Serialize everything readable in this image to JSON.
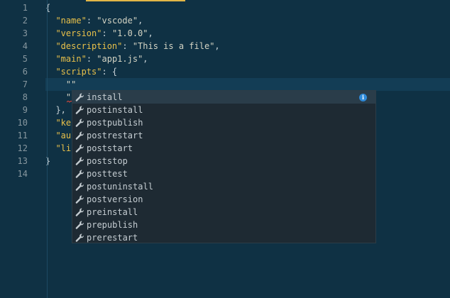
{
  "colors": {
    "background": "#0f3144",
    "current_line": "#133d55",
    "key": "#e8c04a",
    "string": "#d4d4c4",
    "line_number": "#87979f",
    "suggest_bg": "#1e2a33",
    "suggest_selected": "#2a3d4a",
    "info_accent": "#2f8ad8",
    "tab_accent": "#e2b647"
  },
  "editor": {
    "line_numbers": [
      "1",
      "2",
      "3",
      "4",
      "5",
      "6",
      "7",
      "8",
      "9",
      "10",
      "11",
      "12",
      "13",
      "14"
    ],
    "lines": {
      "l1": "{",
      "l2_key": "\"name\"",
      "l2_val": "\"vscode\"",
      "l3_key": "\"version\"",
      "l3_val": "\"1.0.0\"",
      "l4_key": "\"description\"",
      "l4_val": "\"This is a file\"",
      "l5_key": "\"main\"",
      "l5_val": "\"app1.js\"",
      "l6_key": "\"scripts\"",
      "l6_rest": ": {",
      "l7": "\"\"",
      "l8": "\"",
      "l9": "},",
      "l10": "\"ke",
      "l11": "\"au",
      "l12": "\"li",
      "l13": "}",
      "colon": ": ",
      "comma": ","
    }
  },
  "suggest": {
    "icon": "wrench-icon",
    "info_icon": "info-icon",
    "info_glyph": "i",
    "items": [
      "install",
      "postinstall",
      "postpublish",
      "postrestart",
      "poststart",
      "poststop",
      "posttest",
      "postuninstall",
      "postversion",
      "preinstall",
      "prepublish",
      "prerestart"
    ]
  }
}
